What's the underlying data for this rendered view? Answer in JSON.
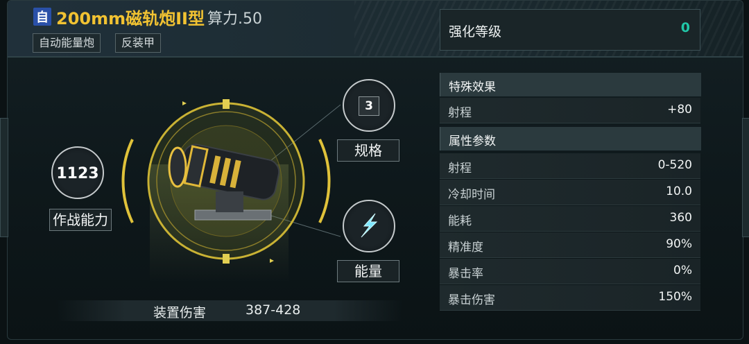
{
  "header": {
    "badge": "自",
    "weapon_name": "200mm磁轨炮II型",
    "power_label": "算力.50",
    "tags": [
      "自动能量炮",
      "反装甲"
    ]
  },
  "enhance": {
    "label": "强化等级",
    "value": "0"
  },
  "special": {
    "title": "特殊效果",
    "rows": [
      {
        "key": "射程",
        "value": "+80"
      }
    ]
  },
  "attributes": {
    "title": "属性参数",
    "rows": [
      {
        "key": "射程",
        "value": "0-520"
      },
      {
        "key": "冷却时间",
        "value": "10.0"
      },
      {
        "key": "能耗",
        "value": "360"
      },
      {
        "key": "精准度",
        "value": "90%"
      },
      {
        "key": "暴击率",
        "value": "0%"
      },
      {
        "key": "暴击伤害",
        "value": "150%"
      }
    ]
  },
  "combat_power": {
    "value": "1123",
    "label": "作战能力"
  },
  "spec": {
    "value": "3",
    "label": "规格"
  },
  "energy": {
    "label": "能量",
    "icon": "energy-icon"
  },
  "damage": {
    "label": "装置伤害",
    "value": "387-428"
  },
  "colors": {
    "accent_gold": "#f1c232",
    "teal": "#21c7a8",
    "badge_blue": "#2a50a8"
  }
}
